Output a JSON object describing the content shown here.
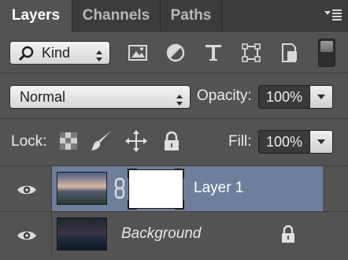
{
  "tabs": [
    {
      "label": "Layers",
      "active": true
    },
    {
      "label": "Channels",
      "active": false
    },
    {
      "label": "Paths",
      "active": false
    }
  ],
  "filter": {
    "kind_label": "Kind",
    "icons": [
      "image-filter-icon",
      "adjustment-filter-icon",
      "type-filter-icon",
      "shape-filter-icon",
      "smart-object-filter-icon"
    ]
  },
  "blend": {
    "mode": "Normal",
    "opacity_label": "Opacity:",
    "opacity_value": "100%"
  },
  "lock": {
    "label": "Lock:",
    "icons": [
      "lock-transparent-pixels-icon",
      "lock-image-pixels-icon",
      "lock-position-icon",
      "lock-all-icon"
    ],
    "fill_label": "Fill:",
    "fill_value": "100%"
  },
  "layers": [
    {
      "name": "Layer 1",
      "selected": true,
      "has_mask": true,
      "locked": false
    },
    {
      "name": "Background",
      "selected": false,
      "has_mask": false,
      "locked": true
    }
  ],
  "colors": {
    "panel_bg": "#535353",
    "selected_layer": "#6d7f9b"
  }
}
